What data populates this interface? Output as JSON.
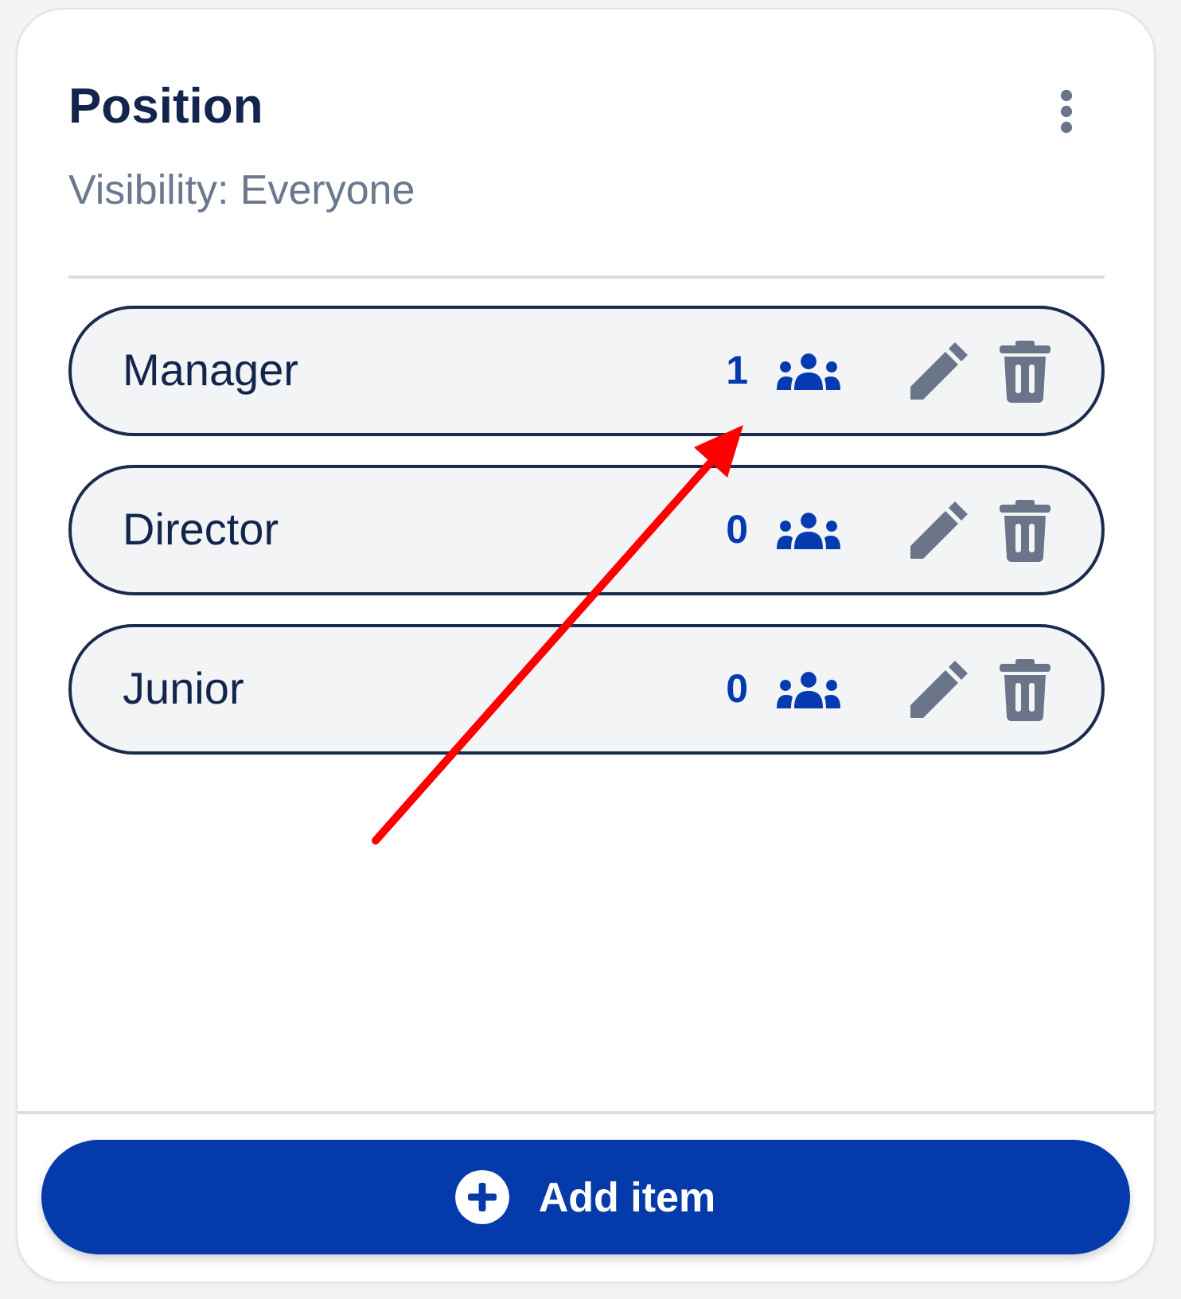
{
  "card": {
    "title": "Position",
    "subtitle": "Visibility: Everyone"
  },
  "items": [
    {
      "label": "Manager",
      "count": "1"
    },
    {
      "label": "Director",
      "count": "0"
    },
    {
      "label": "Junior",
      "count": "0"
    }
  ],
  "add_button": {
    "label": "Add item"
  },
  "annotations": [
    {
      "kind": "arrow"
    }
  ]
}
